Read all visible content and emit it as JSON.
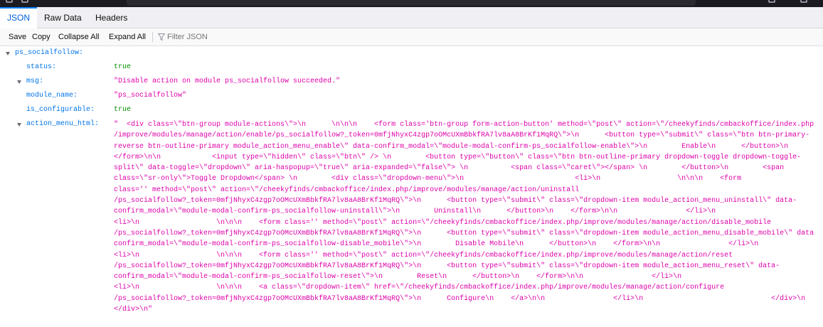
{
  "tabs": [
    {
      "label": "JSON",
      "selected": true
    },
    {
      "label": "Raw Data",
      "selected": false
    },
    {
      "label": "Headers",
      "selected": false
    }
  ],
  "toolbar": {
    "save": "Save",
    "copy": "Copy",
    "collapse_all": "Collapse All",
    "expand_all": "Expand All",
    "filter_placeholder": "Filter JSON",
    "filter_icon": "funnel-icon"
  },
  "tree": {
    "root_key": "ps_socialfollow:",
    "rows": [
      {
        "key": "status:",
        "value": "true",
        "type": "bool"
      },
      {
        "key": "msg:",
        "value": "\"Disable action on module ps_socialfollow succeeded.\"",
        "type": "string"
      },
      {
        "key": "module_name:",
        "value": "\"ps_socialfollow\"",
        "type": "string"
      },
      {
        "key": "is_configurable:",
        "value": "true",
        "type": "bool"
      },
      {
        "key": "action_menu_html:",
        "type": "string"
      }
    ],
    "action_menu_html_lines": [
      "\"  <div class=\\\"btn-group module-actions\\\">\\n      \\n\\n\\n    <form class='btn-group form-action-button' method=\\\"post\\\" action=\\\"/cheekyfinds/cmbackoffice/index.php",
      "/improve/modules/manage/action/enable/ps_socialfollow?_token=0mfjNhyxC4zgp7oOMcUXmBbkfRA7lv8aA8BrKf1MqRQ\\\">\\n      <button type=\\\"submit\\\" class=\\\"btn btn-primary-",
      "reverse btn-outline-primary module_action_menu_enable\\\" data-confirm_modal=\\\"module-modal-confirm-ps_socialfollow-enable\\\">\\n        Enable\\n      </button>\\n",
      "</form>\\n\\n            <input type=\\\"hidden\\\" class=\\\"btn\\\" /> \\n        <button type=\\\"button\\\" class=\\\"btn btn-outline-primary dropdown-toggle dropdown-toggle-",
      "split\\\" data-toggle=\\\"dropdown\\\" aria-haspopup=\\\"true\\\" aria-expanded=\\\"false\\\"> \\n          <span class=\\\"caret\\\"></span> \\n        </button>\\n        <span",
      "class=\\\"sr-only\\\">Toggle Dropdown</span> \\n        <div class=\\\"dropdown-menu\\\">\\n                          <li>\\n                  \\n\\n\\n    <form",
      "class='' method=\\\"post\\\" action=\\\"/cheekyfinds/cmbackoffice/index.php/improve/modules/manage/action/uninstall",
      "/ps_socialfollow?_token=0mfjNhyxC4zgp7oOMcUXmBbkfRA7lv8aA8BrKf1MqRQ\\\">\\n      <button type=\\\"submit\\\" class=\\\"dropdown-item module_action_menu_uninstall\\\" data-",
      "confirm_modal=\\\"module-modal-confirm-ps_socialfollow-uninstall\\\">\\n        Uninstall\\n      </button>\\n    </form>\\n\\n                </li>\\n",
      "<li>\\n                  \\n\\n\\n    <form class='' method=\\\"post\\\" action=\\\"/cheekyfinds/cmbackoffice/index.php/improve/modules/manage/action/disable_mobile",
      "/ps_socialfollow?_token=0mfjNhyxC4zgp7oOMcUXmBbkfRA7lv8aA8BrKf1MqRQ\\\">\\n      <button type=\\\"submit\\\" class=\\\"dropdown-item module_action_menu_disable_mobile\\\" data-",
      "confirm_modal=\\\"module-modal-confirm-ps_socialfollow-disable_mobile\\\">\\n        Disable Mobile\\n      </button>\\n    </form>\\n\\n                </li>\\n",
      "<li>\\n                  \\n\\n\\n    <form class='' method=\\\"post\\\" action=\\\"/cheekyfinds/cmbackoffice/index.php/improve/modules/manage/action/reset",
      "/ps_socialfollow?_token=0mfjNhyxC4zgp7oOMcUXmBbkfRA7lv8aA8BrKf1MqRQ\\\">\\n      <button type=\\\"submit\\\" class=\\\"dropdown-item module_action_menu_reset\\\" data-",
      "confirm_modal=\\\"module-modal-confirm-ps_socialfollow-reset\\\">\\n        Reset\\n      </button>\\n    </form>\\n\\n                </li>\\n",
      "<li>\\n                  \\n\\n\\n    <a class=\\\"dropdown-item\\\" href=\\\"/cheekyfinds/cmbackoffice/index.php/improve/modules/manage/action/configure",
      "/ps_socialfollow?_token=0mfjNhyxC4zgp7oOMcUXmBbkfRA7lv8aA8BrKf1MqRQ\\\">\\n      Configure\\n    </a>\\n\\n                </li>\\n                              </div>\\n",
      "</div>\\n\""
    ]
  }
}
